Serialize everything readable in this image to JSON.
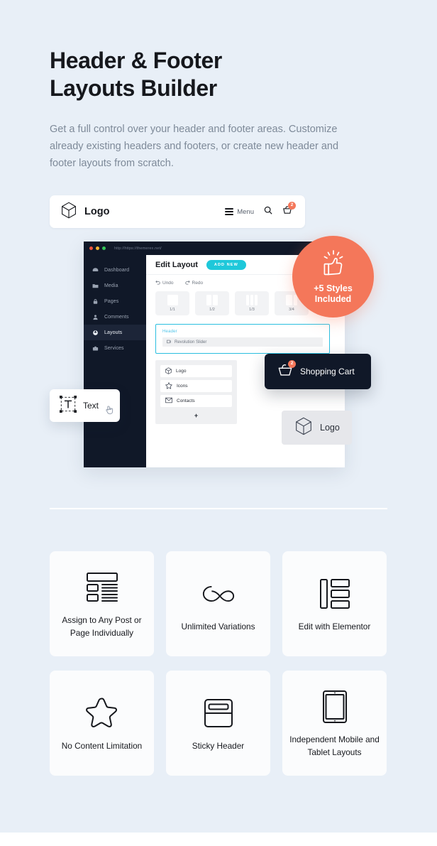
{
  "hero": {
    "title_line1": "Header & Footer",
    "title_line2": "Layouts Builder",
    "subtitle": "Get a full control over your header and footer areas. Customize already existing headers and footers, or create new header and footer layouts from scratch."
  },
  "colors": {
    "page_background": "#e8eff7",
    "accent_orange": "#f4775a",
    "accent_teal": "#1ec8da",
    "dark": "#101828",
    "selection_blue": "#2bbfe0"
  },
  "site_header_preview": {
    "logo_icon": "cube-icon",
    "logo_label": "Logo",
    "menu_icon": "hamburger-icon",
    "menu_label": "Menu",
    "search_icon": "search-icon",
    "cart_icon": "shopping-cart-icon",
    "cart_count": "2"
  },
  "browser_mock": {
    "url": "http://https://themerex.net/",
    "traffic_lights": [
      "close-red",
      "minimize-yellow",
      "maximize-green"
    ],
    "sidebar": [
      {
        "label": "Dashboard",
        "icon": "dashboard-icon",
        "active": false
      },
      {
        "label": "Media",
        "icon": "media-folder-icon",
        "active": false
      },
      {
        "label": "Pages",
        "icon": "lock-pages-icon",
        "active": false
      },
      {
        "label": "Comments",
        "icon": "user-comments-icon",
        "active": false
      },
      {
        "label": "Layouts",
        "icon": "layouts-icon",
        "active": true
      },
      {
        "label": "Services",
        "icon": "services-briefcase-icon",
        "active": false
      }
    ],
    "editor": {
      "title": "Edit Layout",
      "add_new_label": "ADD NEW",
      "undo_label": "Undo",
      "redo_label": "Redo",
      "undo_icon": "undo-arrow-icon",
      "redo_icon": "redo-arrow-icon",
      "column_presets": [
        {
          "label": "1/1",
          "cols": [
            1
          ]
        },
        {
          "label": "1/2",
          "cols": [
            1,
            1
          ]
        },
        {
          "label": "1/3",
          "cols": [
            1,
            1,
            1
          ]
        },
        {
          "label": "3/4",
          "cols": [
            2,
            1
          ]
        }
      ],
      "selected_block": {
        "label": "Header",
        "widget_icon": "slider-widget-icon",
        "widget_label": "Revolution Slider"
      },
      "widget_list": [
        {
          "label": "Logo",
          "icon": "cube-icon"
        },
        {
          "label": "Icons",
          "icon": "star-icon"
        },
        {
          "label": "Contacts",
          "icon": "envelope-icon"
        }
      ],
      "add_widget_label": "+"
    }
  },
  "callouts": {
    "styles_badge": {
      "icon": "thumbs-up-icon",
      "line1": "+5 Styles",
      "line2": "Included"
    },
    "shopping_cart": {
      "icon": "shopping-cart-icon",
      "badge": "2",
      "label": "Shopping Cart"
    },
    "text_tool": {
      "icon": "text-tool-icon",
      "label": "Text",
      "cursor_icon": "hand-cursor-icon"
    },
    "logo_widget": {
      "icon": "cube-icon",
      "label": "Logo"
    }
  },
  "features": [
    {
      "icon": "list-layout-icon",
      "label": "Assign to Any Post or Page Individually"
    },
    {
      "icon": "infinity-icon",
      "label": "Unlimited Variations"
    },
    {
      "icon": "sidebar-layout-icon",
      "label": "Edit with Elementor"
    },
    {
      "icon": "star-outline-icon",
      "label": "No Content Limitation"
    },
    {
      "icon": "sticky-header-icon",
      "label": "Sticky Header"
    },
    {
      "icon": "tablet-icon",
      "label": "Independent Mobile and Tablet Layouts"
    }
  ]
}
